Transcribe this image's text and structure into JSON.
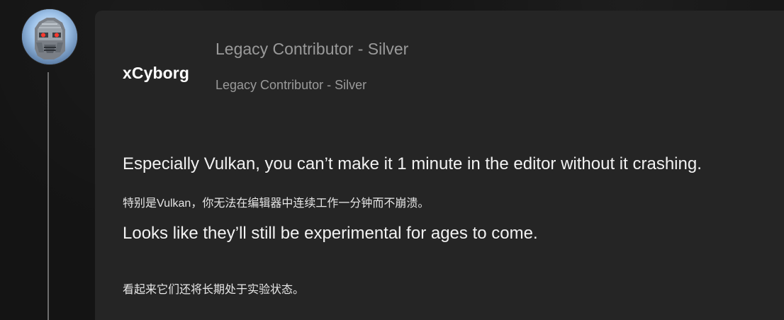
{
  "post": {
    "username": "xCyborg",
    "rank_title": "Legacy Contributor - Silver",
    "rank_subtitle": "Legacy Contributor - Silver",
    "body": [
      "Especially Vulkan, you can’t make it 1 minute in the editor without it crashing.",
      "特别是Vulkan，你无法在编辑器中连续工作一分钟而不崩溃。",
      "Looks like they’ll still be experimental for ages to come.",
      "看起来它们还将长期处于实验状态。"
    ]
  }
}
